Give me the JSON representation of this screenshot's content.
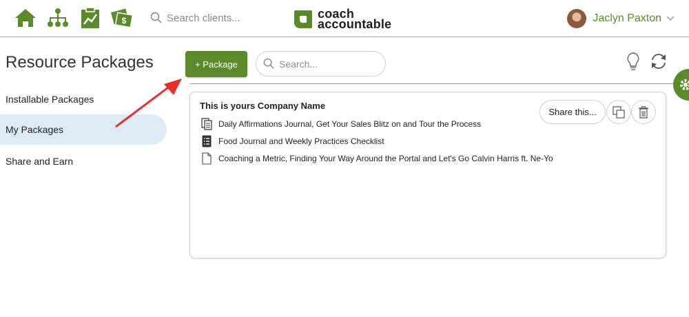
{
  "topbar": {
    "icons": [
      "home-icon",
      "org-chart-icon",
      "clipboard-chart-icon",
      "money-icon"
    ],
    "search_placeholder": "Search clients...",
    "logo": {
      "line1": "coach",
      "line2": "accountable"
    },
    "user_name": "Jaclyn Paxton"
  },
  "sidebar": {
    "title": "Resource Packages",
    "items": [
      {
        "label": "Installable Packages",
        "active": false
      },
      {
        "label": "My Packages",
        "active": true
      },
      {
        "label": "Share and Earn",
        "active": false
      }
    ]
  },
  "toolbar": {
    "add_label": "+ Package",
    "search_placeholder": "Search...",
    "icons": [
      "lightbulb-icon",
      "refresh-icon"
    ]
  },
  "card": {
    "title": "This is yours Company Name",
    "share_label": "Share this...",
    "items": [
      {
        "label": "Daily Affirmations Journal, Get Your Sales Blitz on and Tour the Process",
        "icon": "copy-document-icon"
      },
      {
        "label": "Food Journal and Weekly Practices Checklist",
        "icon": "list-document-icon"
      },
      {
        "label": "Coaching a Metric, Finding Your Way Around the Portal and Let's Go Calvin Harris ft. Ne-Yo",
        "icon": "document-icon"
      }
    ]
  },
  "colors": {
    "brand_green": "#5b8a2b",
    "active_bg": "#dcebf6",
    "annotation_red": "#e8302a"
  }
}
